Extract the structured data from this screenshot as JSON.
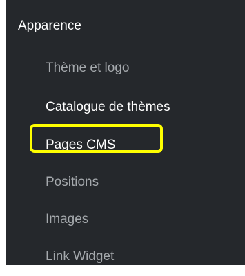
{
  "menu": {
    "header": "Apparence",
    "items": [
      {
        "label": "Thème et logo"
      },
      {
        "label": "Catalogue de thèmes"
      },
      {
        "label": "Pages CMS"
      },
      {
        "label": "Positions"
      },
      {
        "label": "Images"
      },
      {
        "label": "Link Widget"
      }
    ]
  },
  "colors": {
    "background": "#25282c",
    "text_active": "#ffffff",
    "text_muted": "#a5a9ad",
    "highlight": "#ffff00"
  }
}
